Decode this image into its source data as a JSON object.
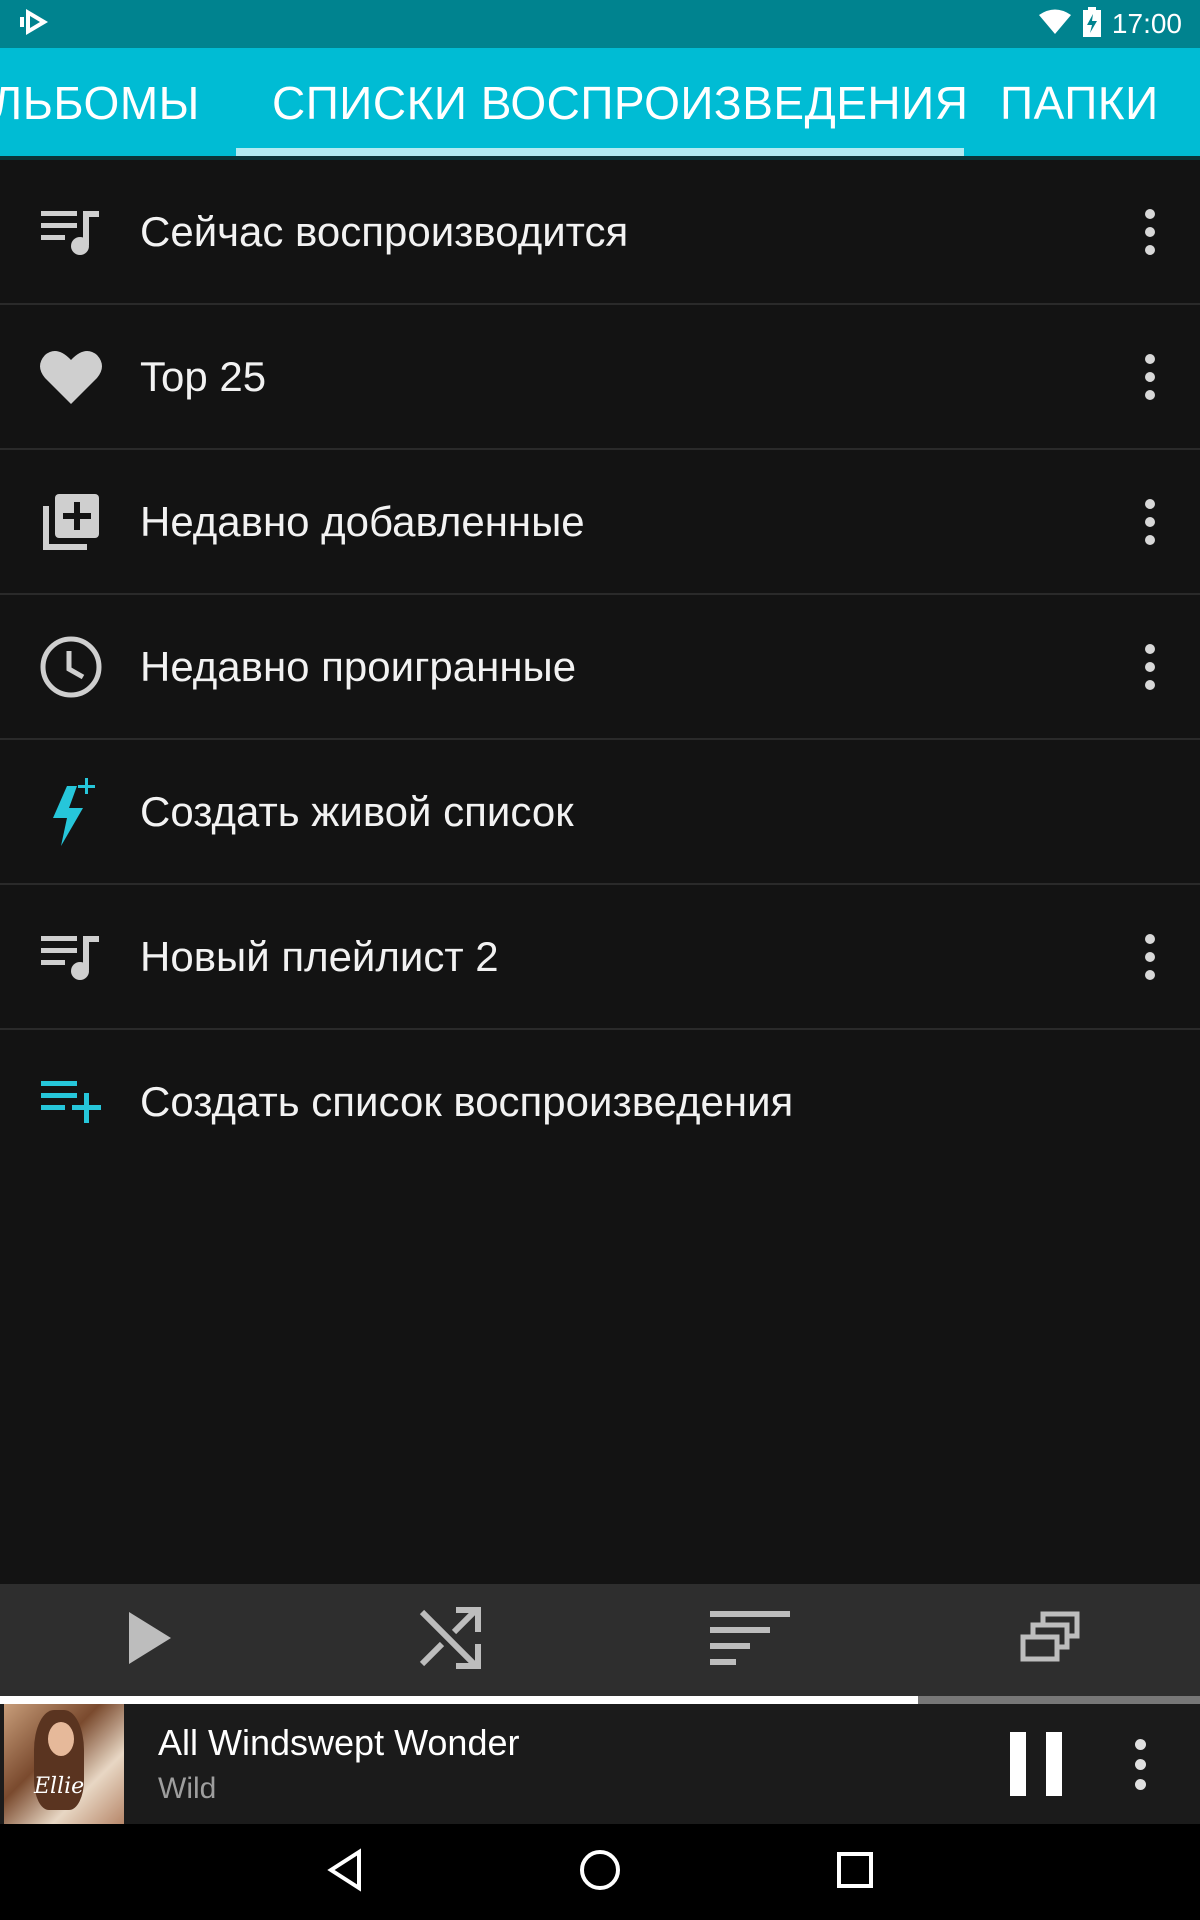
{
  "status_bar": {
    "time": "17:00",
    "icons": [
      "app-notification-icon",
      "wifi-icon",
      "battery-charging-icon"
    ]
  },
  "tabs": [
    {
      "label": "ЛЬБОМЫ",
      "selected": false
    },
    {
      "label": "СПИСКИ ВОСПРОИЗВЕДЕНИЯ",
      "selected": true
    },
    {
      "label": "ПАПКИ",
      "selected": false
    }
  ],
  "playlists": [
    {
      "label": "Сейчас воспроизводится",
      "icon": "queue-music-icon",
      "has_menu": true
    },
    {
      "label": "Top 25",
      "icon": "heart-icon",
      "has_menu": true
    },
    {
      "label": "Недавно добавленные",
      "icon": "library-add-icon",
      "has_menu": true
    },
    {
      "label": "Недавно проигранные",
      "icon": "clock-icon",
      "has_menu": true
    },
    {
      "label": "Создать живой список",
      "icon": "lightning-plus-icon",
      "has_menu": false
    },
    {
      "label": "Новый плейлист 2",
      "icon": "queue-music-icon",
      "has_menu": true
    },
    {
      "label": "Создать список воспроизведения",
      "icon": "playlist-add-icon",
      "has_menu": false
    }
  ],
  "action_bar": [
    "play-icon",
    "shuffle-icon",
    "sort-icon",
    "select-multiple-icon"
  ],
  "now_playing": {
    "title": "All Windswept Wonder",
    "artist": "Wild",
    "progress": 0.765
  },
  "colors": {
    "status_bar": "#00838f",
    "tab_bar": "#00bcd4",
    "accent": "#26c6da",
    "background": "#131313"
  }
}
